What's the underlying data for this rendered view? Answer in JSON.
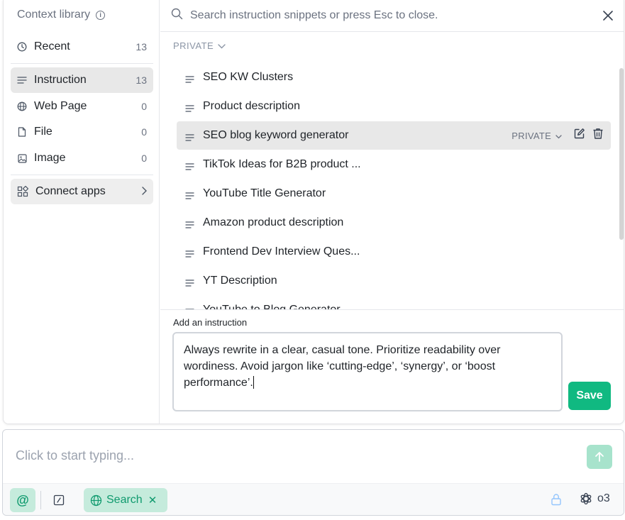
{
  "sidebar": {
    "title": "Context library",
    "items": [
      {
        "label": "Recent",
        "count": "13",
        "icon": "clock-icon"
      },
      {
        "label": "Instruction",
        "count": "13",
        "icon": "lines-icon"
      },
      {
        "label": "Web Page",
        "count": "0",
        "icon": "globe-icon"
      },
      {
        "label": "File",
        "count": "0",
        "icon": "file-icon"
      },
      {
        "label": "Image",
        "count": "0",
        "icon": "image-icon"
      }
    ],
    "connect_label": "Connect apps"
  },
  "search": {
    "placeholder": "Search instruction snippets or press Esc to close."
  },
  "list": {
    "section_label": "PRIVATE",
    "items": [
      "SEO KW Clusters",
      "Product description",
      "SEO blog keyword generator",
      "TikTok Ideas for B2B product ...",
      "YouTube Title Generator",
      "Amazon product description",
      "Frontend Dev Interview Ques...",
      "YT Description",
      "YouTube to Blog Generator"
    ],
    "highlight_visibility": "PRIVATE"
  },
  "add_instruction": {
    "label": "Add an instruction",
    "text": "Always rewrite in a clear, casual tone. Prioritize readability over wordiness. Avoid jargon like ‘cutting-edge’, ‘synergy’, or ‘boost performance’.",
    "save_label": "Save"
  },
  "composer": {
    "placeholder": "Click to start typing...",
    "at_label": "@",
    "search_chip_label": "Search",
    "model_label": "o3"
  },
  "colors": {
    "accent": "#10b981",
    "chip_bg": "#c5ebdc",
    "highlight_bg": "#e8e8e8"
  }
}
